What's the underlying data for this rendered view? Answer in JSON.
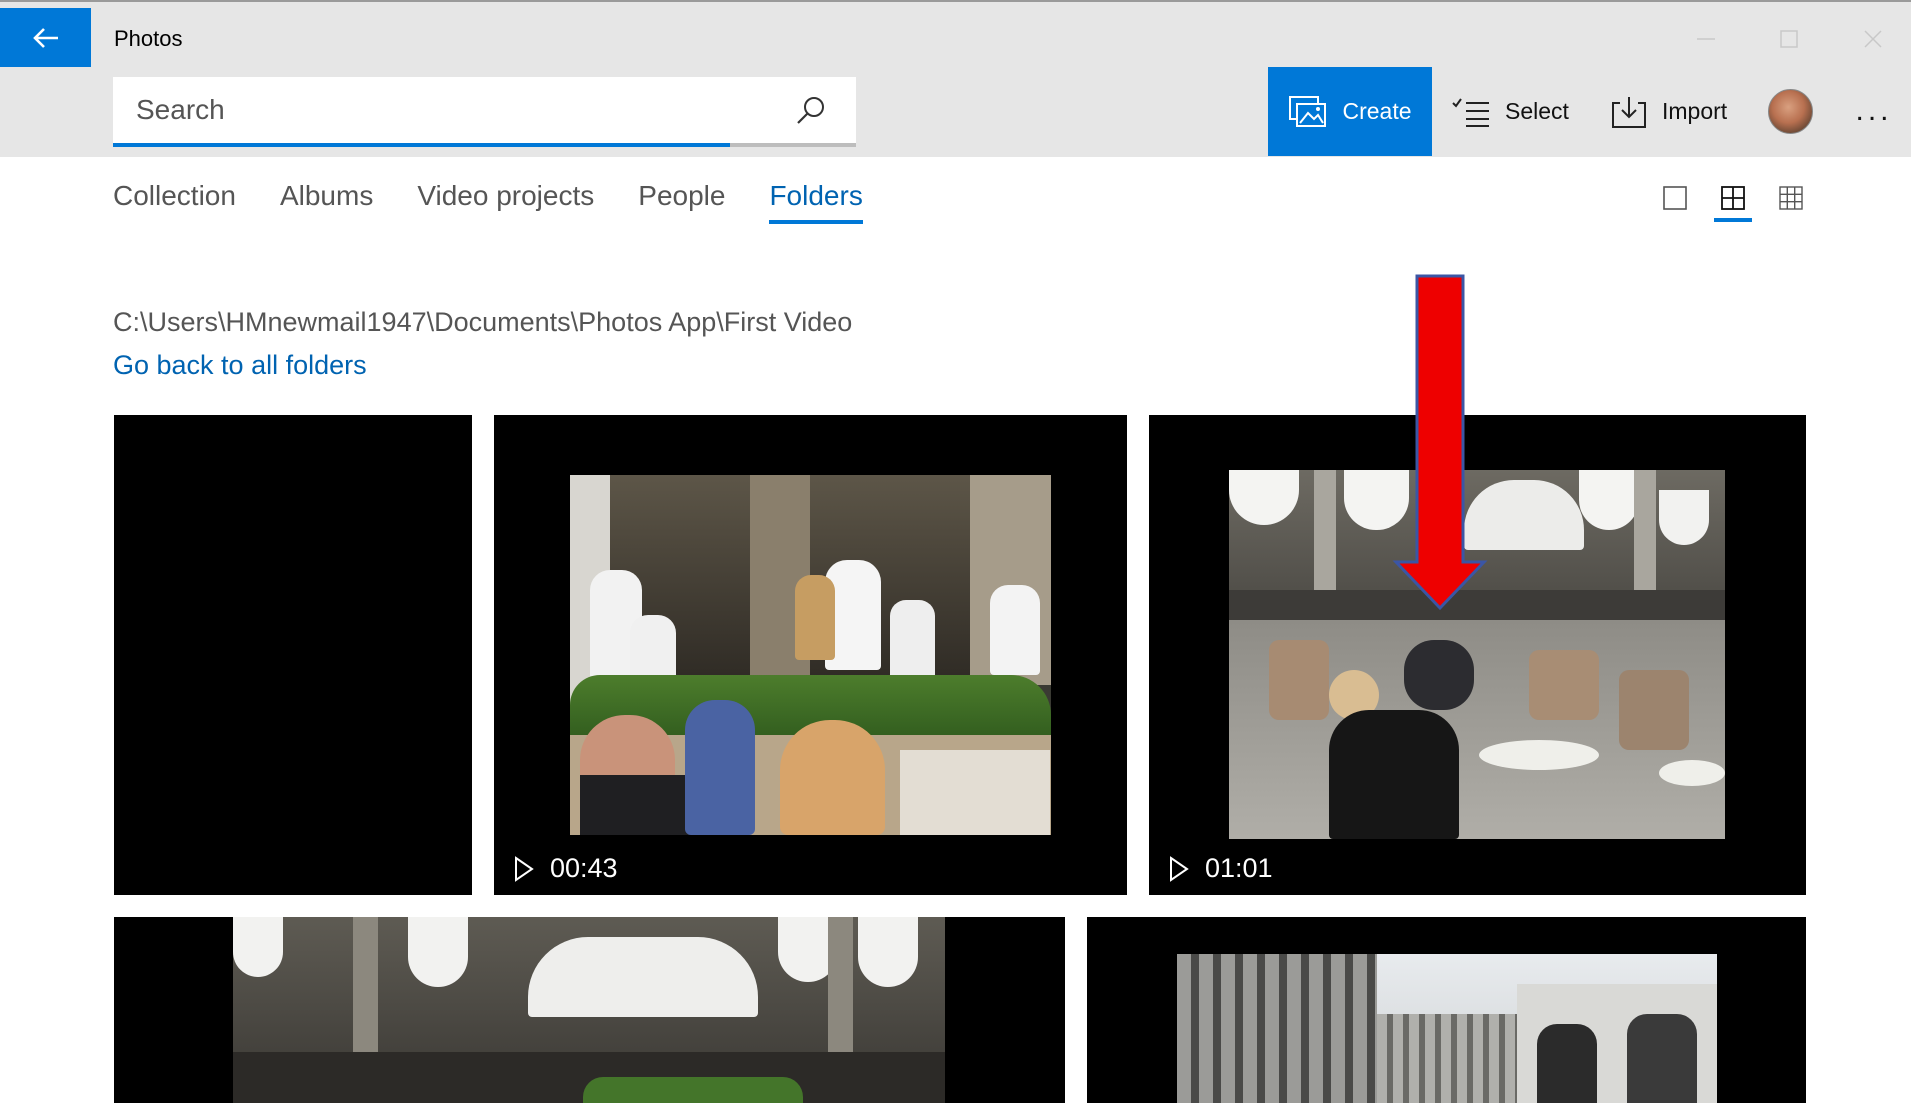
{
  "app": {
    "title": "Photos"
  },
  "toolbar": {
    "search_placeholder": "Search",
    "create_label": "Create",
    "select_label": "Select",
    "import_label": "Import",
    "more_label": "..."
  },
  "tabs": [
    {
      "label": "Collection",
      "active": false
    },
    {
      "label": "Albums",
      "active": false
    },
    {
      "label": "Video projects",
      "active": false
    },
    {
      "label": "People",
      "active": false
    },
    {
      "label": "Folders",
      "active": true
    }
  ],
  "folder": {
    "path": "C:\\Users\\HMnewmail1947\\Documents\\Photos App\\First Video",
    "back_link": "Go back to all folders"
  },
  "tiles": [
    {
      "kind": "blank"
    },
    {
      "kind": "video",
      "duration": "00:43"
    },
    {
      "kind": "video",
      "duration": "01:01"
    },
    {
      "kind": "video"
    },
    {
      "kind": "photo"
    }
  ],
  "colors": {
    "accent": "#0078d7",
    "link": "#0063b1",
    "annotation_arrow": "#ee0000"
  },
  "icons": [
    "back-arrow-icon",
    "search-icon",
    "create-icon",
    "select-icon",
    "import-icon",
    "more-icon",
    "single-view-icon",
    "medium-grid-icon",
    "small-grid-icon",
    "play-icon"
  ]
}
